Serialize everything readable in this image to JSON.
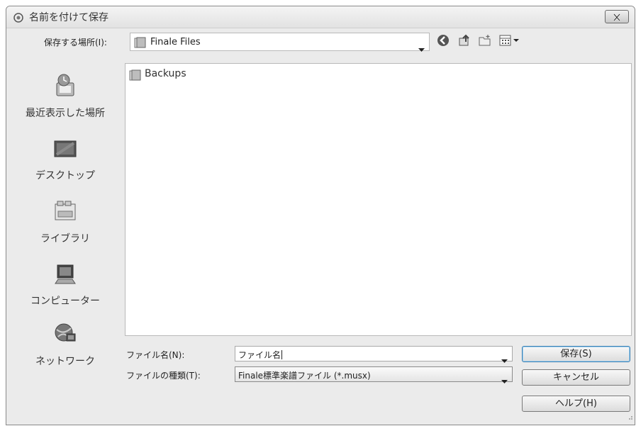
{
  "window": {
    "title": "名前を付けて保存"
  },
  "location": {
    "label": "保存する場所(I):",
    "value": "Finale Files"
  },
  "toolbar": {
    "icons": [
      "back-icon",
      "up-folder-icon",
      "new-folder-icon",
      "view-menu-icon"
    ]
  },
  "places": [
    {
      "key": "recent",
      "label": "最近表示した場所"
    },
    {
      "key": "desktop",
      "label": "デスクトップ"
    },
    {
      "key": "library",
      "label": "ライブラリ"
    },
    {
      "key": "computer",
      "label": "コンピューター"
    },
    {
      "key": "network",
      "label": "ネットワーク"
    }
  ],
  "files": [
    {
      "name": "Backups",
      "type": "folder"
    }
  ],
  "filename": {
    "label": "ファイル名(N):",
    "value": "ファイル名"
  },
  "filetype": {
    "label": "ファイルの種類(T):",
    "value": "Finale標準楽譜ファイル (*.musx)"
  },
  "buttons": {
    "save": "保存(S)",
    "cancel": "キャンセル",
    "help": "ヘルプ(H)"
  },
  "colors": {
    "accent": "#3c7fb1",
    "folder": "#c9c9c9"
  }
}
